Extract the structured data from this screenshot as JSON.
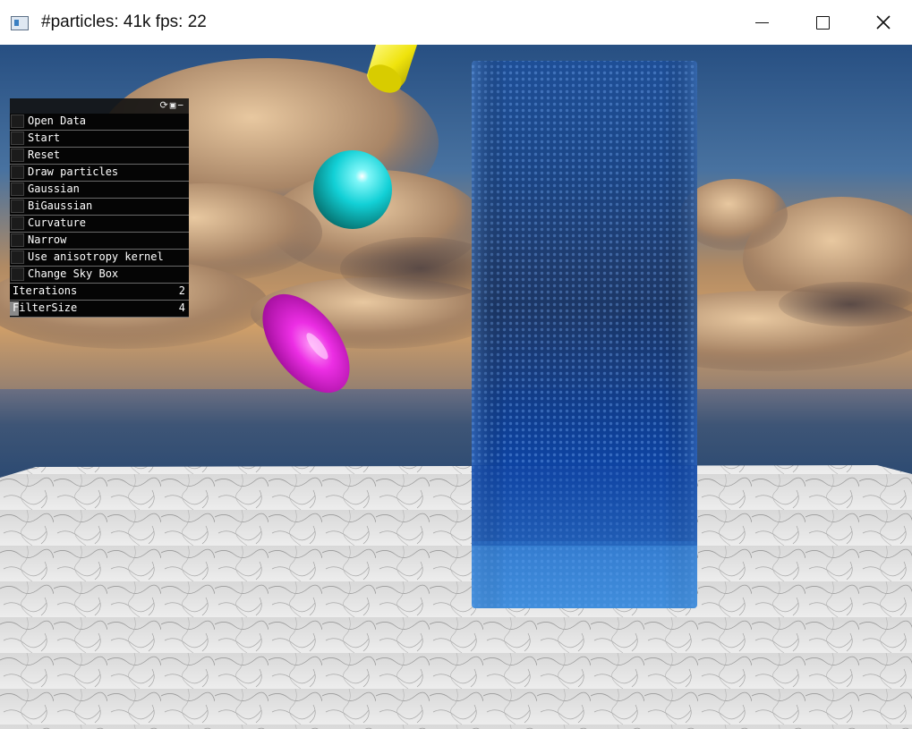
{
  "window": {
    "title": "#particles: 41k fps: 22"
  },
  "controls": {
    "buttons": [
      {
        "label": "Open Data"
      },
      {
        "label": "Start"
      },
      {
        "label": "Reset"
      },
      {
        "label": "Draw particles"
      },
      {
        "label": "Gaussian"
      },
      {
        "label": "BiGaussian"
      },
      {
        "label": "Curvature"
      },
      {
        "label": "Narrow"
      },
      {
        "label": "Use anisotropy kernel"
      },
      {
        "label": "Change Sky Box"
      }
    ],
    "params": [
      {
        "label": "Iterations",
        "value": "2"
      },
      {
        "label": "FilterSize",
        "value": "4"
      }
    ],
    "header_icons": "⟳▣−"
  },
  "scene": {
    "colors": {
      "sky_top": "#2d5a8e",
      "horizon": "#c8955e",
      "sea": "#4a5d78",
      "floor": "#e4e4e4",
      "fluid": "#0f4aa5",
      "sphere": "#14d6dc",
      "torus": "#e61ee0",
      "cylinder": "#f0e60a"
    },
    "objects": [
      "yellow-cylinder",
      "cyan-sphere",
      "magenta-torus",
      "particle-fluid-column",
      "marble-floor",
      "cloudy-sky"
    ]
  }
}
